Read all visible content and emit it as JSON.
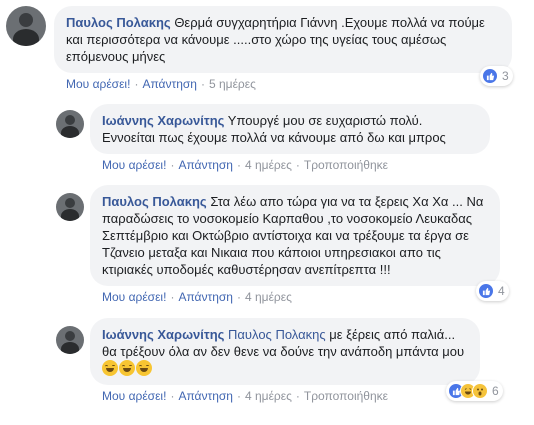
{
  "comments": [
    {
      "author": "Παυλος Πολακης",
      "text": "Θερμά συγχαρητήρια Γιάννη .Εχουμε πολλά να πούμε και περισσότερα να κάνουμε .....στο χώρο της υγείας τους αμέσως επόμενους μήνες",
      "like_label": "Μου αρέσει!",
      "reply_label": "Απάντηση",
      "time": "5 ημέρες",
      "reaction_count": "3"
    },
    {
      "author": "Ιωάννης Χαρωνίτης",
      "text": "Υπουργέ μου σε ευχαριστώ πολύ. Εννοείται πως έχουμε πολλά να κάνουμε από δω και μπρος",
      "like_label": "Μου αρέσει!",
      "reply_label": "Απάντηση",
      "time": "4 ημέρες",
      "edited": "Τροποποιήθηκε"
    },
    {
      "author": "Παυλος Πολακης",
      "text": "Στα λέω απο τώρα για να τα ξερεις Χα Χα ... Να παραδώσεις το νοσοκομείο Καρπαθου ,το νοσοκομείο Λευκαδας Σεπτέμβριο και Οκτώβριο αντίστοιχα και να τρέξουμε τα έργα σε Τζανειο μεταξα και Νικαια που κάποιοι υπηρεσιακοι απο τις κτιριακές υποδομές καθυστέρησαν ανεπίτρεπτα !!!",
      "like_label": "Μου αρέσει!",
      "reply_label": "Απάντηση",
      "time": "4 ημέρες",
      "reaction_count": "4"
    },
    {
      "author": "Ιωάννης Χαρωνίτης",
      "mention": "Παυλος Πολακης",
      "text": "με ξέρεις από παλιά... θα τρέξουν όλα αν δεν θενε να δούνε την ανάποδη μπάντα μου",
      "like_label": "Μου αρέσει!",
      "reply_label": "Απάντηση",
      "time": "4 ημέρες",
      "edited": "Τροποποιήθηκε",
      "reaction_count": "6"
    }
  ],
  "reaction_icons": {
    "like": "like-icon",
    "haha": "haha-icon",
    "wow": "wow-icon"
  },
  "separator": "·"
}
